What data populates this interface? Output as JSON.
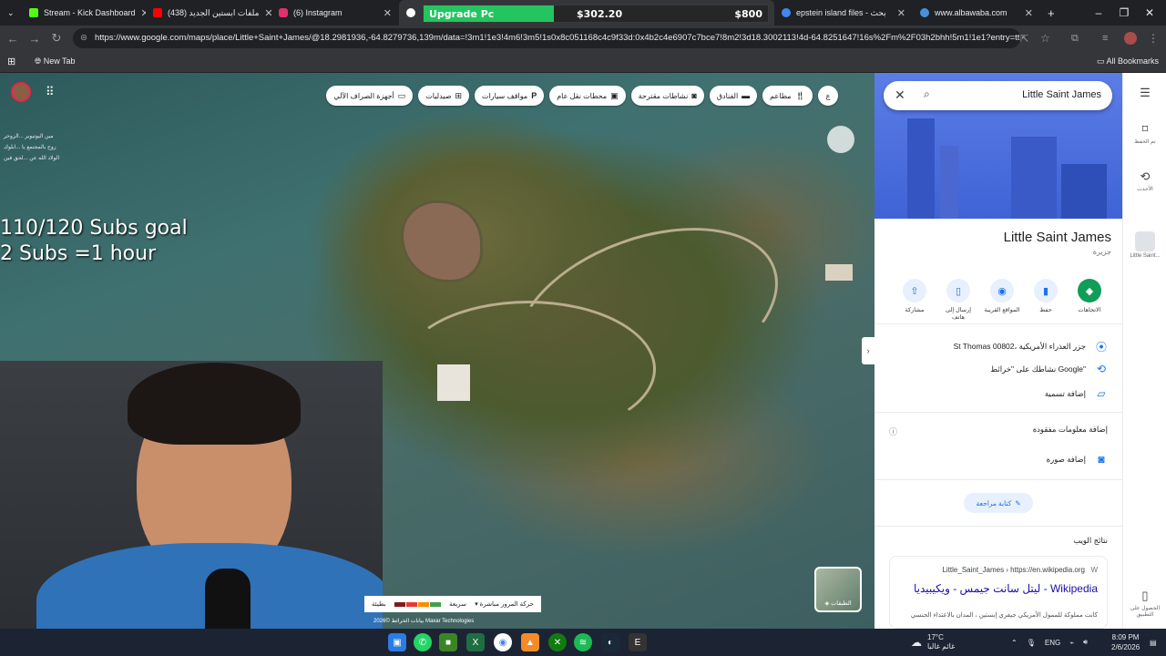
{
  "tabs": [
    {
      "title": "Stream - Kick Dashboard",
      "color": "#53fc18"
    },
    {
      "title": "(438) ملفات ابستين الجديد",
      "color": "#ff0000"
    },
    {
      "title": "(6) Instagram",
      "color": "#e1306c"
    },
    {
      "title": "",
      "color": "#ffffff"
    },
    {
      "title": "epstein island files - بحث",
      "color": "#4285f4"
    },
    {
      "title": "www.albawaba.com",
      "color": "#4a90d9"
    }
  ],
  "upgrade_overlay": {
    "label": "Upgrade Pc",
    "current": "$302.20",
    "goal": "$800",
    "progress": 0.378
  },
  "address_bar": {
    "url": "https://www.google.com/maps/place/Little+Saint+James/@18.2981936,-64.8279736,139m/data=!3m1!1e3!4m6!3m5!1s0x8c051168c4c9f33d:0x4b2c4e6907c7bce7!8m2!3d18.3002113!4d-64.8251647!16s%2Fm%2F03h2bhh!5m1!1e1?entry=ttu&..."
  },
  "bookmarks": {
    "new_tab": "New Tab",
    "all_bookmarks": "All Bookmarks"
  },
  "map_filters": [
    {
      "label": "مطاعم",
      "icon": "utensils-icon"
    },
    {
      "label": "الفنادق",
      "icon": "bed-icon"
    },
    {
      "label": "نشاطات مقترحة",
      "icon": "camera-icon"
    },
    {
      "label": "محطات نقل عام",
      "icon": "transit-icon"
    },
    {
      "label": "مواقف سيارات",
      "icon": "parking-icon"
    },
    {
      "label": "صيدليات",
      "icon": "pharmacy-icon"
    },
    {
      "label": "أجهزة الصراف الآلي",
      "icon": "atm-icon"
    }
  ],
  "map_more": "ع",
  "stream_overlay": {
    "goal_line1": "110/120 Subs goal",
    "goal_line2": "2 Subs =1 hour"
  },
  "chat_lines": [
    "مين اليوتيوبر ...الزوحر",
    "روح بالمجتمع يا ...ابلوك",
    "الولاد الله عن ...لحق فين"
  ],
  "search": {
    "query": "Little Saint James"
  },
  "place": {
    "title": "Little Saint James",
    "subtitle": "جزيرة",
    "actions": [
      {
        "label": "الاتجاهات",
        "icon": "directions-icon"
      },
      {
        "label": "حفظ",
        "icon": "bookmark-icon"
      },
      {
        "label": "المواقع القريبة",
        "icon": "nearby-icon"
      },
      {
        "label": "إرسال إلى هاتف",
        "icon": "phone-icon"
      },
      {
        "label": "مشاركة",
        "icon": "share-icon"
      }
    ],
    "address": "St Thomas 00802، جزر العذراء الأمريكية",
    "activity": "نشاطك على \"خرائط Google\"",
    "add_label": "إضافة تسمية",
    "missing_info": "إضافة معلومات مفقودة",
    "add_photo": "إضافة صورة",
    "write_review": "كتابة مراجعة",
    "web_results_heading": "نتائج الويب",
    "web_result": {
      "source": "Little_Saint_James › https://en.wikipedia.org",
      "title": "ليتل سانت جيمس - ويكيبيديا - Wikipedia",
      "snippet": "كانت مملوكة للممول الأمريكي جيفري إبستين ، المدان بالاعتداء الجنسي"
    }
  },
  "right_rail": [
    {
      "label": "تم الحفظ",
      "icon": "bookmark-icon"
    },
    {
      "label": "الأحدث",
      "icon": "history-icon"
    },
    {
      "label": "Little Saint...",
      "icon": "place-thumb-icon"
    },
    {
      "label": "الحصول على التطبيق",
      "icon": "mobile-icon"
    }
  ],
  "map_controls": {
    "layers": "الطبقات",
    "traffic_label": "حركة المرور مباشرة",
    "traffic_fast": "سريعة",
    "traffic_slow": "بطيئة",
    "attribution": "بيانات الخرائط ©2026 Maxar Technologies"
  },
  "taskbar": {
    "weather_temp": "17°C",
    "weather_desc": "غائم غالبا",
    "lang": "ENG",
    "time": "8:09 PM",
    "date": "2/6/2026"
  }
}
